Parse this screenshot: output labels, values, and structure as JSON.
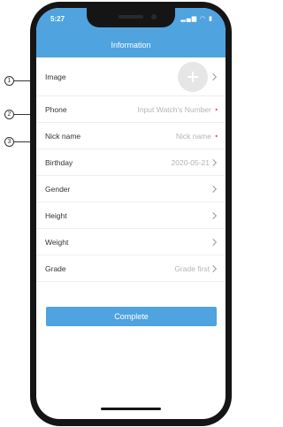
{
  "status_bar": {
    "time": "5:27",
    "icons": "▂▄▆ ◠ ▮"
  },
  "header": {
    "title": "Information"
  },
  "form": {
    "image_label": "Image",
    "phone_label": "Phone",
    "phone_placeholder": "Input Watch's Number",
    "nickname_label": "Nick name",
    "nickname_placeholder": "Nick name",
    "birthday_label": "Birthday",
    "birthday_value": "2020-05-21",
    "gender_label": "Gender",
    "height_label": "Height",
    "weight_label": "Weight",
    "grade_label": "Grade",
    "grade_value": "Grade first",
    "required_marker": "•"
  },
  "complete_label": "Complete",
  "callouts": [
    "1",
    "2",
    "3"
  ],
  "colors": {
    "accent": "#4fa3df",
    "required": "#e04848",
    "placeholder": "#b5b5b5"
  },
  "icons": {
    "chevron": "chevron-right-icon",
    "avatar_add": "plus-icon"
  }
}
